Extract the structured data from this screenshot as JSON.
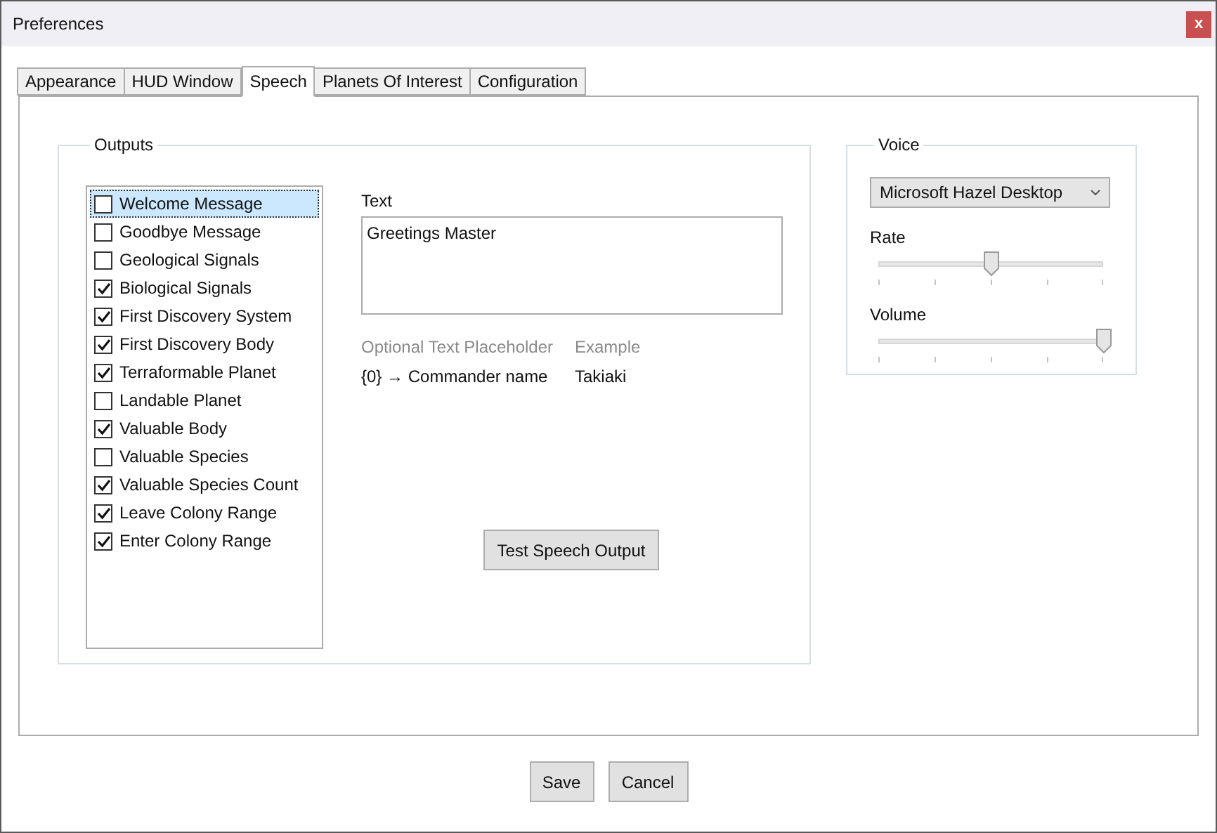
{
  "window": {
    "title": "Preferences",
    "close": "x"
  },
  "tabs": [
    {
      "label": "Appearance",
      "selected": false
    },
    {
      "label": "HUD Window",
      "selected": false
    },
    {
      "label": "Speech",
      "selected": true
    },
    {
      "label": "Planets Of Interest",
      "selected": false
    },
    {
      "label": "Configuration",
      "selected": false
    }
  ],
  "outputs": {
    "title": "Outputs",
    "items": [
      {
        "label": "Welcome Message",
        "checked": false,
        "selected": true
      },
      {
        "label": "Goodbye Message",
        "checked": false,
        "selected": false
      },
      {
        "label": "Geological Signals",
        "checked": false,
        "selected": false
      },
      {
        "label": "Biological Signals",
        "checked": true,
        "selected": false
      },
      {
        "label": "First Discovery System",
        "checked": true,
        "selected": false
      },
      {
        "label": "First Discovery Body",
        "checked": true,
        "selected": false
      },
      {
        "label": "Terraformable Planet",
        "checked": true,
        "selected": false
      },
      {
        "label": "Landable Planet",
        "checked": false,
        "selected": false
      },
      {
        "label": "Valuable Body",
        "checked": true,
        "selected": false
      },
      {
        "label": "Valuable Species",
        "checked": false,
        "selected": false
      },
      {
        "label": "Valuable Species Count",
        "checked": true,
        "selected": false
      },
      {
        "label": "Leave Colony Range",
        "checked": true,
        "selected": false
      },
      {
        "label": "Enter Colony Range",
        "checked": true,
        "selected": false
      }
    ],
    "text_label": "Text",
    "text_value": "Greetings Master",
    "placeholder_columns": [
      "Optional Text Placeholder",
      "Example"
    ],
    "placeholder_rows": [
      [
        "{0} → Commander name",
        "Takiaki"
      ]
    ],
    "test_button": "Test Speech Output"
  },
  "voice": {
    "title": "Voice",
    "selection": "Microsoft Hazel Desktop",
    "sliders": [
      {
        "label": "Rate",
        "level": 0.5
      },
      {
        "label": "Volume",
        "level": 1.0
      }
    ]
  },
  "buttons": [
    "Save",
    "Cancel"
  ]
}
